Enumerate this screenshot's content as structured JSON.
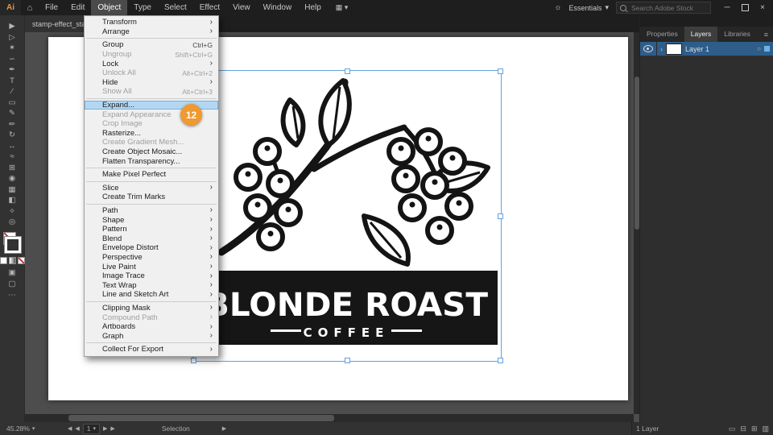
{
  "colors": {
    "badge": "#f0992e",
    "menu_highlight": "#b3d7f3",
    "selection_blue": "#64a1dd",
    "layer_selected_row": "#2e5d8a"
  },
  "titlebar": {
    "app_logo": "Ai",
    "menus": [
      "File",
      "Edit",
      "Object",
      "Type",
      "Select",
      "Effect",
      "View",
      "Window",
      "Help"
    ],
    "active_menu": "Object",
    "workspace_label": "Essentials",
    "search_placeholder": "Search Adobe Stock"
  },
  "document_tab": {
    "label": "stamp-effect_start.ai"
  },
  "object_menu": {
    "items": [
      {
        "label": "Transform",
        "submenu": true
      },
      {
        "label": "Arrange",
        "submenu": true
      },
      {
        "sep": true
      },
      {
        "label": "Group",
        "shortcut": "Ctrl+G"
      },
      {
        "label": "Ungroup",
        "shortcut": "Shift+Ctrl+G",
        "disabled": true
      },
      {
        "label": "Lock",
        "submenu": true
      },
      {
        "label": "Unlock All",
        "shortcut": "Alt+Ctrl+2",
        "disabled": true
      },
      {
        "label": "Hide",
        "submenu": true
      },
      {
        "label": "Show All",
        "shortcut": "Alt+Ctrl+3",
        "disabled": true
      },
      {
        "sep": true
      },
      {
        "label": "Expand...",
        "highlighted": true
      },
      {
        "label": "Expand Appearance",
        "disabled": true
      },
      {
        "label": "Crop Image",
        "disabled": true
      },
      {
        "label": "Rasterize..."
      },
      {
        "label": "Create Gradient Mesh...",
        "disabled": true
      },
      {
        "label": "Create Object Mosaic..."
      },
      {
        "label": "Flatten Transparency..."
      },
      {
        "sep": true
      },
      {
        "label": "Make Pixel Perfect"
      },
      {
        "sep": true
      },
      {
        "label": "Slice",
        "submenu": true
      },
      {
        "label": "Create Trim Marks"
      },
      {
        "sep": true
      },
      {
        "label": "Path",
        "submenu": true
      },
      {
        "label": "Shape",
        "submenu": true
      },
      {
        "label": "Pattern",
        "submenu": true
      },
      {
        "label": "Blend",
        "submenu": true
      },
      {
        "label": "Envelope Distort",
        "submenu": true
      },
      {
        "label": "Perspective",
        "submenu": true
      },
      {
        "label": "Live Paint",
        "submenu": true
      },
      {
        "label": "Image Trace",
        "submenu": true
      },
      {
        "label": "Text Wrap",
        "submenu": true
      },
      {
        "label": "Line and Sketch Art",
        "submenu": true
      },
      {
        "sep": true
      },
      {
        "label": "Clipping Mask",
        "submenu": true
      },
      {
        "label": "Compound Path",
        "submenu": true,
        "disabled": true
      },
      {
        "label": "Artboards",
        "submenu": true
      },
      {
        "label": "Graph",
        "submenu": true
      },
      {
        "sep": true
      },
      {
        "label": "Collect For Export",
        "submenu": true
      }
    ]
  },
  "step_badge": {
    "label": "12"
  },
  "artwork": {
    "title": "BLONDE ROAST",
    "subtitle": "COFFEE"
  },
  "toolbar": {
    "tools": [
      {
        "name": "selection-tool",
        "glyph": "▶"
      },
      {
        "name": "direct-selection-tool",
        "glyph": "▷"
      },
      {
        "name": "magic-wand-tool",
        "glyph": "✶"
      },
      {
        "name": "lasso-tool",
        "glyph": "∽"
      },
      {
        "name": "pen-tool",
        "glyph": "✒"
      },
      {
        "name": "type-tool",
        "glyph": "T"
      },
      {
        "name": "line-segment-tool",
        "glyph": "∕"
      },
      {
        "name": "rectangle-tool",
        "glyph": "▭"
      },
      {
        "name": "paintbrush-tool",
        "glyph": "✎"
      },
      {
        "name": "pencil-tool",
        "glyph": "✏"
      },
      {
        "name": "rotate-tool",
        "glyph": "↻"
      },
      {
        "name": "scale-tool",
        "glyph": "↔"
      },
      {
        "name": "width-tool",
        "glyph": "≈"
      },
      {
        "name": "free-transform-tool",
        "glyph": "⊞"
      },
      {
        "name": "shape-builder-tool",
        "glyph": "◉"
      },
      {
        "name": "mesh-tool",
        "glyph": "▦"
      },
      {
        "name": "gradient-tool",
        "glyph": "◧"
      },
      {
        "name": "eyedropper-tool",
        "glyph": "✧"
      },
      {
        "name": "blend-tool",
        "glyph": "◎"
      }
    ],
    "bottom_icons": [
      {
        "name": "draw-normal-mode-button",
        "glyph": "▣"
      },
      {
        "name": "change-screen-mode-button",
        "glyph": "▢"
      },
      {
        "name": "edit-toolbar-button",
        "glyph": "⋯"
      }
    ]
  },
  "right_panel": {
    "tabs": [
      "Properties",
      "Layers",
      "Libraries"
    ],
    "active_tab": "Layers",
    "layers": [
      {
        "name": "Layer 1",
        "selected": true
      }
    ],
    "footer_label": "1 Layer",
    "footer_icons": [
      {
        "name": "make-clipping-mask-icon",
        "glyph": "▭"
      },
      {
        "name": "create-new-sublayer-icon",
        "glyph": "⊟"
      },
      {
        "name": "create-new-layer-icon",
        "glyph": "⊞"
      },
      {
        "name": "delete-layer-icon",
        "glyph": "▥"
      }
    ]
  },
  "statusbar": {
    "zoom": "45.28%",
    "artboard_number": "1",
    "tool_label": "Selection"
  }
}
